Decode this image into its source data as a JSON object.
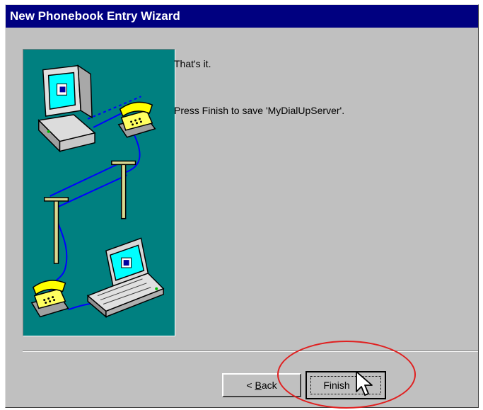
{
  "window": {
    "title": "New Phonebook Entry Wizard"
  },
  "content": {
    "line1": "That's it.",
    "line2": "Press Finish to save 'MyDialUpServer'."
  },
  "buttons": {
    "back_prefix": "< ",
    "back_accel": "B",
    "back_rest": "ack",
    "finish_label": "Finish"
  },
  "colors": {
    "titlebar": "#000080",
    "dialog_bg": "#c0c0c0",
    "illustration_bg": "#008080",
    "annotation": "#e02020"
  },
  "icons": {
    "illustration": "dialup-network-illustration",
    "cursor": "mouse-pointer-icon"
  }
}
